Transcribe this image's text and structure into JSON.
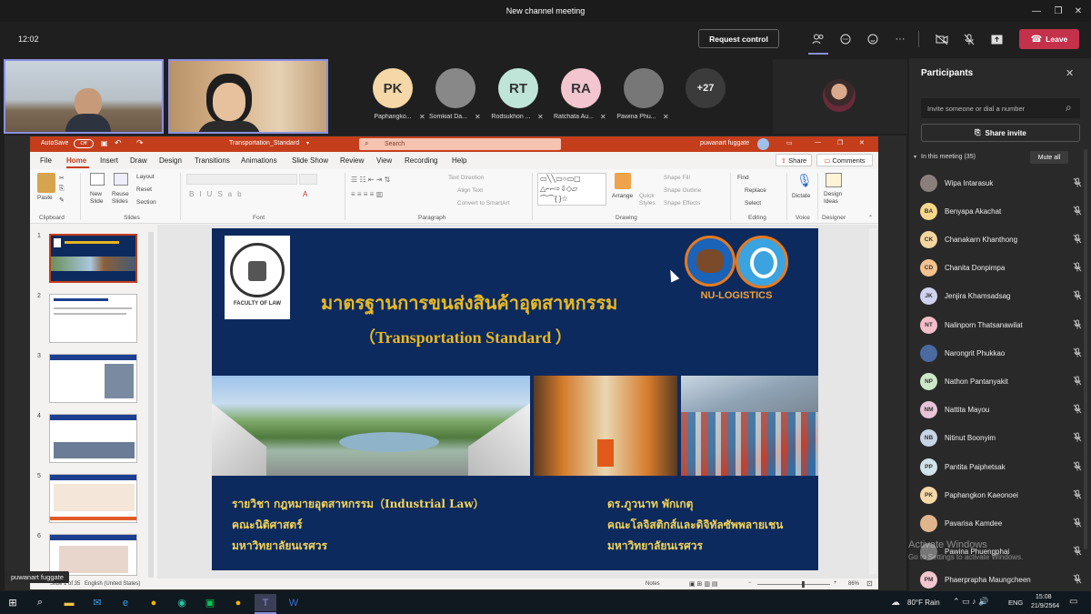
{
  "window": {
    "title": "New channel meeting"
  },
  "meeting": {
    "clock": "12:02",
    "request_control": "Request control",
    "leave": "Leave",
    "more": "···",
    "presenter_name": "puwanart fuggate",
    "video_tiles": [
      {
        "name": "Paphangko...",
        "initials": "PK",
        "color": "#f6d7a7"
      },
      {
        "name": "Somkiat Da...",
        "initials": "",
        "color": "#888888"
      },
      {
        "name": "Rodsukhon ...",
        "initials": "RT",
        "color": "#bfe4d8"
      },
      {
        "name": "Ratchata Au...",
        "initials": "RA",
        "color": "#f3c6cf"
      },
      {
        "name": "Pawina Phu...",
        "initials": "",
        "color": "#777777"
      }
    ],
    "overflow_count": "+27"
  },
  "powerpoint": {
    "autosave": "AutoSave",
    "toggle": "Off",
    "filename": "Transportation_Standard",
    "search": "Search",
    "user": "puwanart fuggate",
    "tabs": [
      "File",
      "Home",
      "Insert",
      "Draw",
      "Design",
      "Transitions",
      "Animations",
      "Slide Show",
      "Review",
      "View",
      "Recording",
      "Help"
    ],
    "share": "Share",
    "comments": "Comments",
    "groups": [
      "Clipboard",
      "Slides",
      "Font",
      "Paragraph",
      "Drawing",
      "Editing",
      "Voice",
      "Designer"
    ],
    "ribbon": {
      "paste": "Paste",
      "new_slide": "New Slide",
      "reuse_slides": "Reuse Slides",
      "layout": "Layout",
      "reset": "Reset",
      "section": "Section",
      "text_direction": "Text Direction",
      "align_text": "Align Text",
      "convert_smartart": "Convert to SmartArt",
      "arrange": "Arrange",
      "quick_styles": "Quick Styles",
      "shape_fill": "Shape Fill",
      "shape_outline": "Shape Outline",
      "shape_effects": "Shape Effects",
      "find": "Find",
      "replace": "Replace",
      "select": "Select",
      "dictate": "Dictate",
      "design_ideas": "Design Ideas"
    },
    "thumb_numbers": [
      "1",
      "2",
      "3",
      "4",
      "5",
      "6"
    ],
    "status": {
      "slide": "Slide 1 of 35",
      "language": "English (United States)",
      "notes": "Notes",
      "zoom": "86%"
    }
  },
  "slide": {
    "title_th": "มาตรฐานการขนส่งสินค้าอุตสาหกรรม",
    "title_en": "（Transportation Standard ）",
    "logo_left_text": "FACULTY OF LAW",
    "logo_right_text": "NU-LOGISTICS",
    "left_lines": [
      "รายวิชา กฎหมายอุตสาหกรรม（Industrial Law）",
      "คณะนิติศาสตร์",
      "มหาวิทยาลัยนเรศวร"
    ],
    "right_lines": [
      "ดร.ภูวนาท พักเกตุ",
      "คณะโลจิสติกส์และดิจิทัลซัพพลายเชน",
      "มหาวิทยาลัยนเรศวร"
    ]
  },
  "participants": {
    "title": "Participants",
    "invite_placeholder": "Invite someone or dial a number",
    "share_invite": "Share invite",
    "in_meeting": "In this meeting (35)",
    "mute_all": "Mute all",
    "people": [
      {
        "name": "Wipa Intarasuk",
        "initials": "",
        "color": "#8a7f7a"
      },
      {
        "name": "Benyapa Akachat",
        "initials": "BA",
        "color": "#f6d78a"
      },
      {
        "name": "Chanakarn Khanthong",
        "initials": "CK",
        "color": "#f3d6a0"
      },
      {
        "name": "Chanita Donpimpa",
        "initials": "CD",
        "color": "#f4c28f"
      },
      {
        "name": "Jenjira Khamsadsag",
        "initials": "JK",
        "color": "#cfd1ef"
      },
      {
        "name": "Nalinporn Thatsanawilat",
        "initials": "NT",
        "color": "#f3bdca"
      },
      {
        "name": "Narongrit Phukkao",
        "initials": "",
        "color": "#4a6aa0"
      },
      {
        "name": "Nathon Pantanyakit",
        "initials": "NP",
        "color": "#cde8c8"
      },
      {
        "name": "Nattita Mayou",
        "initials": "NM",
        "color": "#e9c3d8"
      },
      {
        "name": "Nitinut Boonyim",
        "initials": "NB",
        "color": "#c7d3e6"
      },
      {
        "name": "Pantita Paiphetsak",
        "initials": "PP",
        "color": "#cfe3ea"
      },
      {
        "name": "Paphangkon Kaeonoei",
        "initials": "PK",
        "color": "#f6d7a7"
      },
      {
        "name": "Pavarisa Kamdee",
        "initials": "",
        "color": "#e1b58c"
      },
      {
        "name": "Pawina Phuengphai",
        "initials": "",
        "color": "#777777"
      },
      {
        "name": "Phaerprapha Maungcheen",
        "initials": "PM",
        "color": "#f3c6cf"
      }
    ]
  },
  "activate": {
    "line1": "Activate Windows",
    "line2": "Go to Settings to activate Windows."
  },
  "taskbar": {
    "weather": "80°F  Rain",
    "lang": "ENG",
    "time": "15:08",
    "date": "21/9/2564"
  }
}
